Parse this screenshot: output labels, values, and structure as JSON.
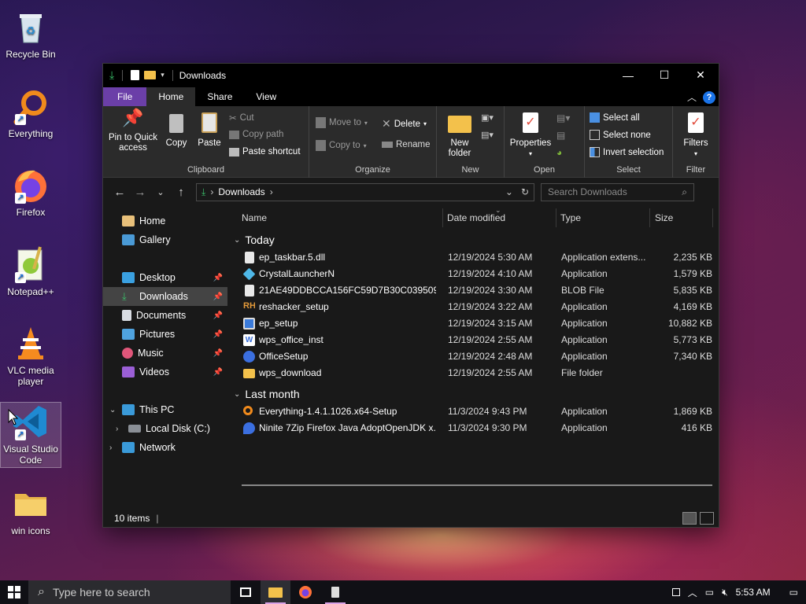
{
  "desktop": {
    "icons": [
      {
        "label": "Recycle Bin"
      },
      {
        "label": "Everything"
      },
      {
        "label": "Firefox"
      },
      {
        "label": "Notepad++"
      },
      {
        "label": "VLC media player"
      },
      {
        "label": "Visual Studio Code"
      },
      {
        "label": "win icons"
      }
    ]
  },
  "window": {
    "title": "Downloads",
    "tabs": [
      "File",
      "Home",
      "Share",
      "View"
    ],
    "active_tab": "Home",
    "ribbon": {
      "clipboard": {
        "pin": "Pin to Quick access",
        "copy": "Copy",
        "paste": "Paste",
        "cut": "Cut",
        "copy_path": "Copy path",
        "paste_shortcut": "Paste shortcut",
        "label": "Clipboard"
      },
      "organize": {
        "move_to": "Move to",
        "copy_to": "Copy to",
        "delete": "Delete",
        "rename": "Rename",
        "label": "Organize"
      },
      "new": {
        "new_folder": "New folder",
        "label": "New"
      },
      "open": {
        "properties": "Properties",
        "label": "Open"
      },
      "select": {
        "select_all": "Select all",
        "select_none": "Select none",
        "invert": "Invert selection",
        "label": "Select"
      },
      "filter": {
        "filters": "Filters",
        "label": "Filter"
      }
    },
    "address": {
      "path": "Downloads",
      "search_placeholder": "Search Downloads"
    },
    "nav": {
      "items": [
        {
          "label": "Home"
        },
        {
          "label": "Gallery"
        },
        {
          "label": "Desktop"
        },
        {
          "label": "Downloads"
        },
        {
          "label": "Documents"
        },
        {
          "label": "Pictures"
        },
        {
          "label": "Music"
        },
        {
          "label": "Videos"
        },
        {
          "label": "This PC"
        },
        {
          "label": "Local Disk (C:)"
        },
        {
          "label": "Network"
        }
      ]
    },
    "columns": {
      "name": "Name",
      "date": "Date modified",
      "type": "Type",
      "size": "Size"
    },
    "groups": {
      "today": {
        "label": "Today",
        "files": [
          {
            "name": "ep_taskbar.5.dll",
            "date": "12/19/2024 5:30 AM",
            "type": "Application extens...",
            "size": "2,235 KB"
          },
          {
            "name": "CrystalLauncherN",
            "date": "12/19/2024 4:10 AM",
            "type": "Application",
            "size": "1,579 KB"
          },
          {
            "name": "21AE49DDBCCA156FC59D7B30C039509C...",
            "date": "12/19/2024 3:30 AM",
            "type": "BLOB File",
            "size": "5,835 KB"
          },
          {
            "name": "reshacker_setup",
            "date": "12/19/2024 3:22 AM",
            "type": "Application",
            "size": "4,169 KB"
          },
          {
            "name": "ep_setup",
            "date": "12/19/2024 3:15 AM",
            "type": "Application",
            "size": "10,882 KB"
          },
          {
            "name": "wps_office_inst",
            "date": "12/19/2024 2:55 AM",
            "type": "Application",
            "size": "5,773 KB"
          },
          {
            "name": "OfficeSetup",
            "date": "12/19/2024 2:48 AM",
            "type": "Application",
            "size": "7,340 KB"
          },
          {
            "name": "wps_download",
            "date": "12/19/2024 2:55 AM",
            "type": "File folder",
            "size": ""
          }
        ]
      },
      "last_month": {
        "label": "Last month",
        "files": [
          {
            "name": "Everything-1.4.1.1026.x64-Setup",
            "date": "11/3/2024 9:43 PM",
            "type": "Application",
            "size": "1,869 KB"
          },
          {
            "name": "Ninite 7Zip Firefox Java AdoptOpenJDK x...",
            "date": "11/3/2024 9:30 PM",
            "type": "Application",
            "size": "416 KB"
          }
        ]
      }
    },
    "status": {
      "item_count": "10 items"
    }
  },
  "taskbar": {
    "search_placeholder": "Type here to search",
    "clock": "5:53 AM"
  },
  "colors": {
    "file_tab": "#6b3fa8",
    "ribbon_bg": "#2b2b2b",
    "window_bg": "#191919",
    "selection": "#444444",
    "accent_blue": "#1a73e8"
  }
}
